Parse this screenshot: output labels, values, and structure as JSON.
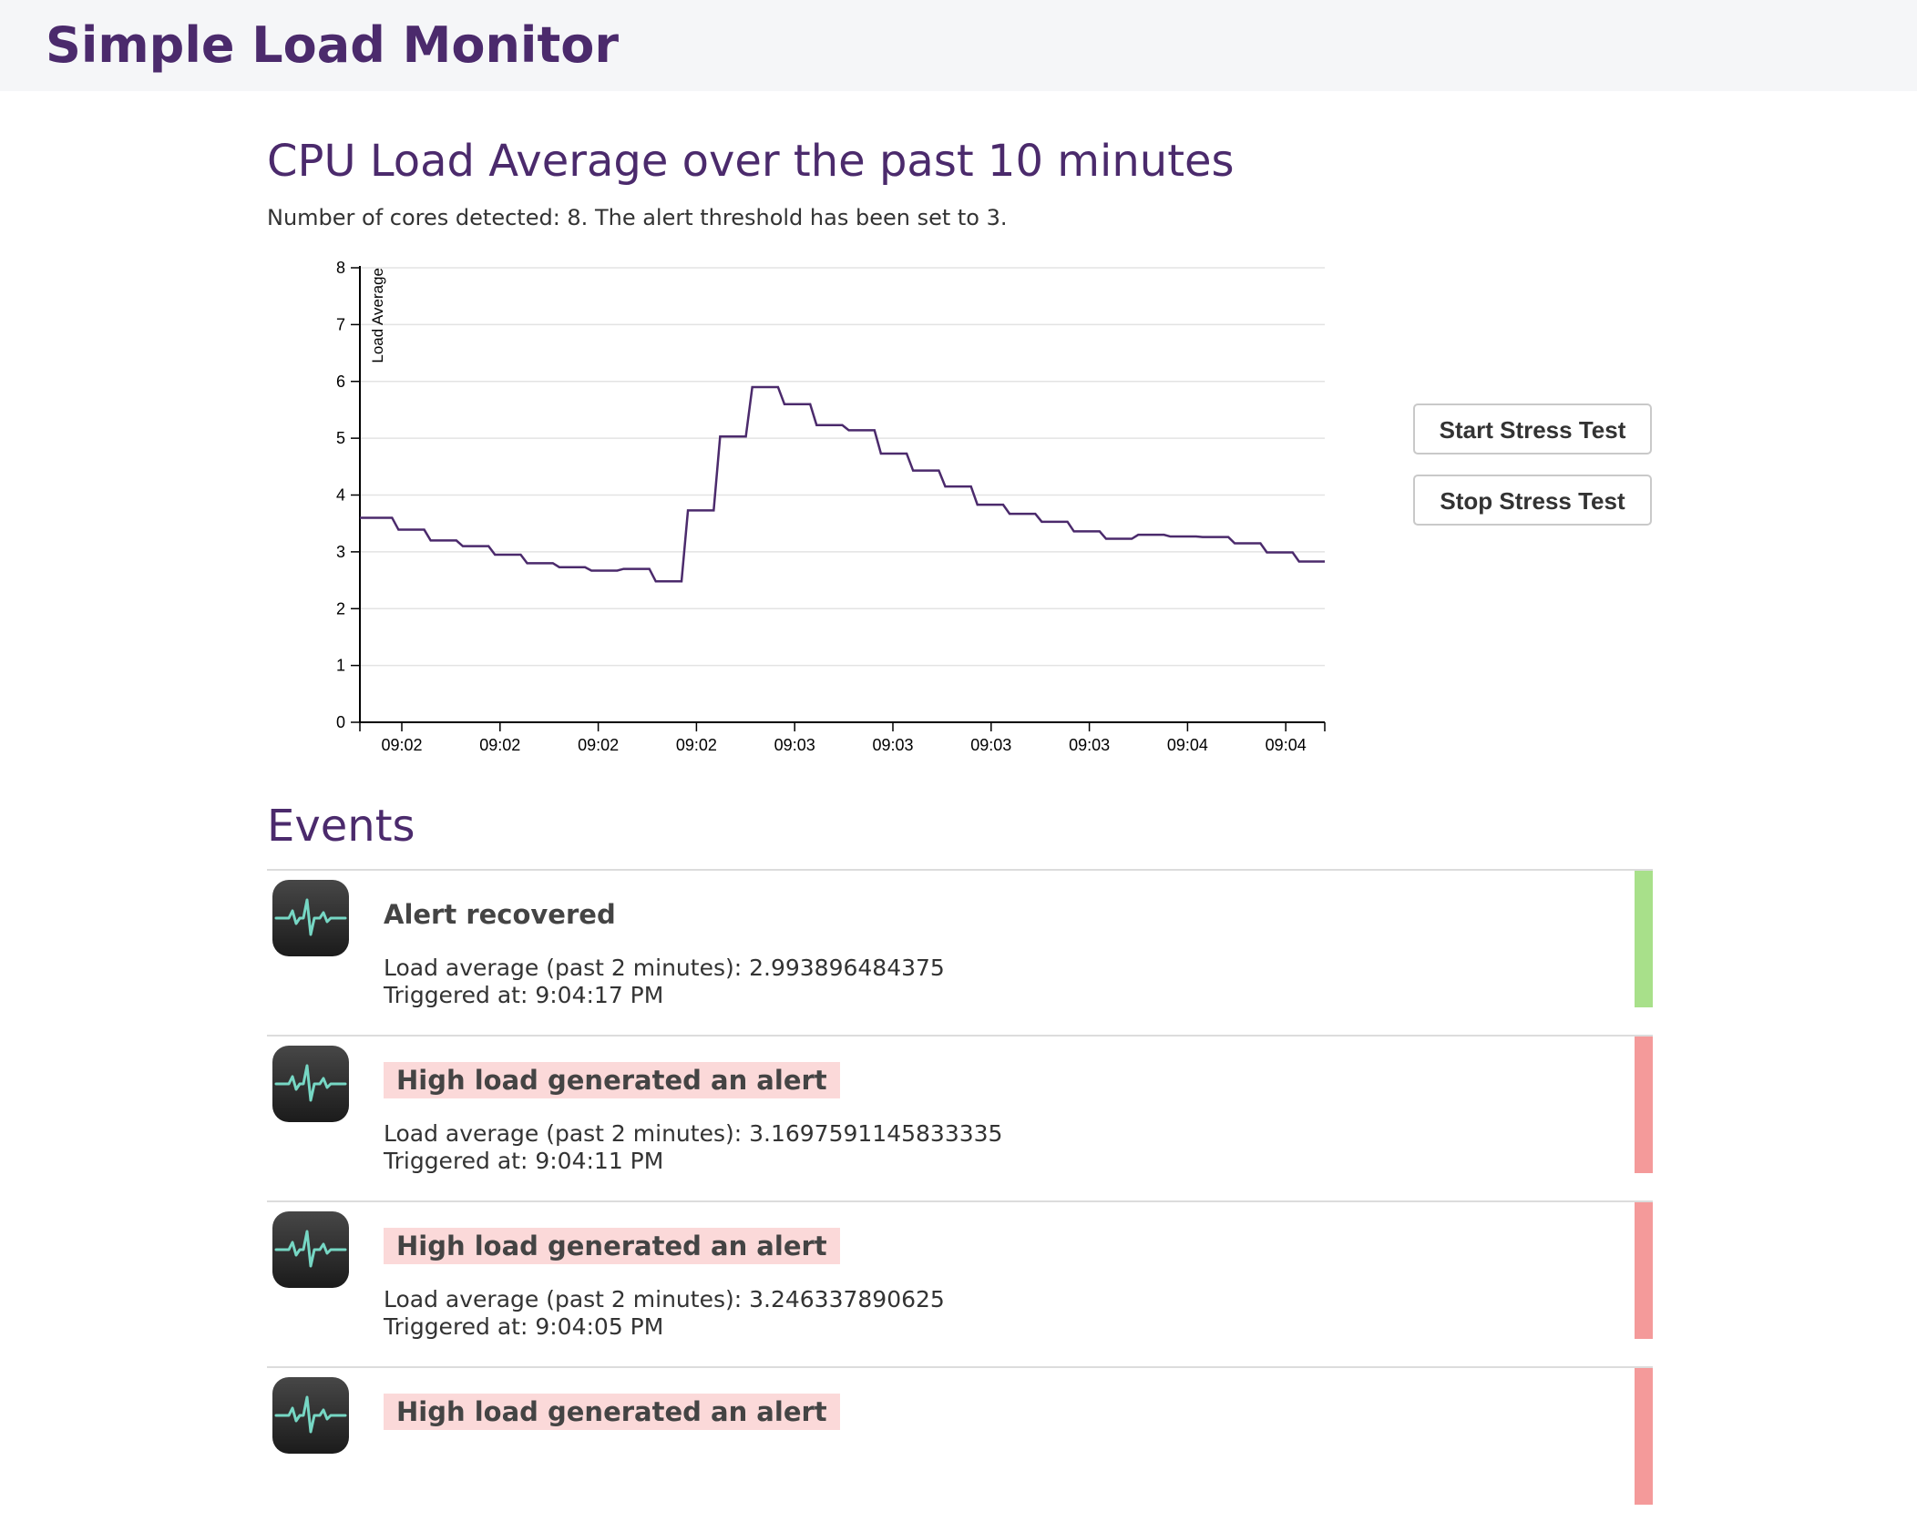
{
  "app": {
    "title": "Simple Load Monitor"
  },
  "main": {
    "title": "CPU Load Average over the past 10 minutes",
    "subtitle": "Number of cores detected: 8. The alert threshold has been set to 3."
  },
  "controls": {
    "start_label": "Start Stress Test",
    "stop_label": "Stop Stress Test"
  },
  "chart_data": {
    "type": "line",
    "ylabel": "Load Average",
    "xlabel": "",
    "ylim": [
      0,
      8
    ],
    "yticks": [
      "0",
      "1",
      "2",
      "3",
      "4",
      "5",
      "6",
      "7",
      "8"
    ],
    "xticks": [
      "09:02",
      "09:02",
      "09:02",
      "09:02",
      "09:03",
      "09:03",
      "09:03",
      "09:03",
      "09:04",
      "09:04"
    ],
    "grid": true,
    "line_color": "#4b2a6c",
    "series": [
      {
        "values": [
          3.6,
          3.39,
          3.2,
          3.1,
          2.95,
          2.8,
          2.73,
          2.67,
          2.7,
          2.48,
          3.73,
          5.03,
          5.9,
          5.6,
          5.23,
          5.14,
          4.73,
          4.43,
          4.15,
          3.83,
          3.67,
          3.53,
          3.36,
          3.23,
          3.3,
          3.27,
          3.26,
          3.15,
          2.99,
          2.83
        ]
      }
    ]
  },
  "events": {
    "title": "Events",
    "items": [
      {
        "kind": "recovered",
        "title": "Alert recovered",
        "load_text": "Load average (past 2 minutes): 2.993896484375",
        "time_text": "Triggered at: 9:04:17 PM",
        "color": "#a8e08a"
      },
      {
        "kind": "alert",
        "title": "High load generated an alert",
        "load_text": "Load average (past 2 minutes): 3.1697591145833335",
        "time_text": "Triggered at: 9:04:11 PM",
        "color": "#f49a9a"
      },
      {
        "kind": "alert",
        "title": "High load generated an alert",
        "load_text": "Load average (past 2 minutes): 3.246337890625",
        "time_text": "Triggered at: 9:04:05 PM",
        "color": "#f49a9a"
      },
      {
        "kind": "alert",
        "title": "High load generated an alert",
        "load_text": "",
        "time_text": "",
        "color": "#f49a9a"
      }
    ]
  }
}
